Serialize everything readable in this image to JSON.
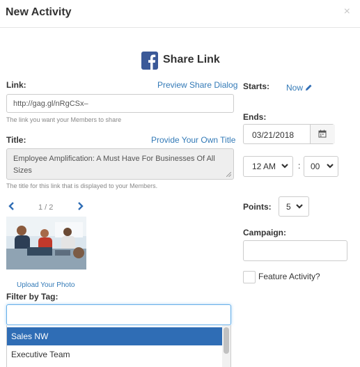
{
  "modal": {
    "title": "New Activity",
    "close_label": "×"
  },
  "share": {
    "title": "Share Link",
    "icon": "facebook-icon",
    "brand_color": "#3b5998"
  },
  "link_field": {
    "label": "Link:",
    "preview_link": "Preview Share Dialog",
    "value": "http://gag.gl/nRgCSx–",
    "help": "The link you want your Members to share"
  },
  "title_field": {
    "label": "Title:",
    "custom_link": "Provide Your Own Title",
    "value": "Employee Amplification: A Must Have For Businesses Of All Sizes",
    "help": "The title for this link that is displayed to your Members."
  },
  "image_pager": {
    "prev_icon": "chevron-left-icon",
    "next_icon": "chevron-right-icon",
    "text": "1 / 2",
    "upload_label": "Upload Your Photo"
  },
  "tag_filter": {
    "label": "Filter by Tag:",
    "input_value": "",
    "options": [
      "Sales NW",
      "Executive Team"
    ],
    "selected_option": "Sales NW"
  },
  "schedule": {
    "starts_label": "Starts:",
    "starts_value": "Now",
    "ends_label": "Ends:",
    "ends_date": "03/21/2018",
    "hour": "12 AM",
    "time_separator": ":",
    "minute": "00"
  },
  "points": {
    "label": "Points:",
    "value": "5"
  },
  "campaign": {
    "label": "Campaign:",
    "value": ""
  },
  "feature": {
    "label": "Feature Activity?",
    "checked": false
  },
  "colors": {
    "link": "#337ab7",
    "selected": "#2f6db5",
    "muted": "#888888"
  }
}
